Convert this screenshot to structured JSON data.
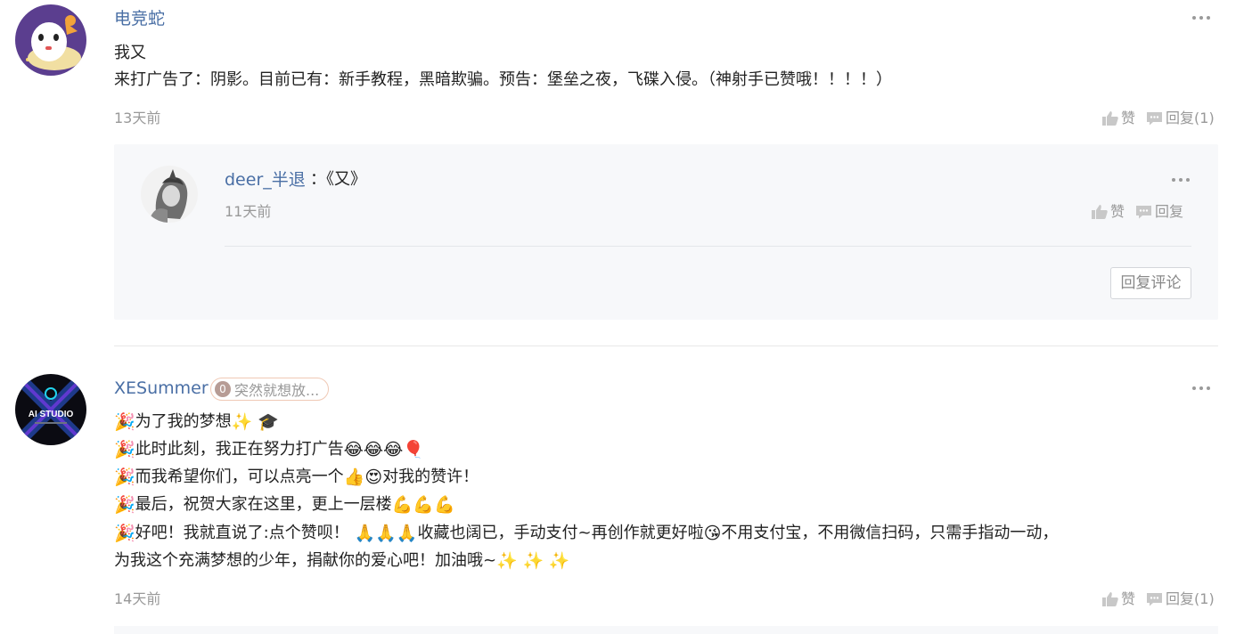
{
  "comments": [
    {
      "username": "电竞蛇",
      "lines": [
        "我又",
        "来打广告了：阴影。目前已有：新手教程，黑暗欺骗。预告：堡垒之夜，飞碟入侵。（神射手已赞哦！！！！）"
      ],
      "time": "13天前",
      "like_label": "赞",
      "reply_label": "回复(1)",
      "replies": [
        {
          "username": "deer_半退",
          "text": "：《又》",
          "time": "11天前",
          "like_label": "赞",
          "reply_label": "回复"
        }
      ],
      "reply_comment_button": "回复评论"
    },
    {
      "username": "XESummer",
      "badge_level": "0",
      "badge_text": "突然就想放...",
      "avatar_text": "AI STUDIO",
      "lines": [
        "为了我的梦想",
        "此时此刻，我正在努力打广告",
        "而我希望你们，可以点亮一个",
        "对我的赞许！",
        "最后，祝贺大家在这里，更上一层楼",
        "好吧！我就直说了:点个赞呗！",
        "收藏也阔已，手动支付~再创作就更好啦",
        "不用支付宝，不用微信扫码，只需手指动一动，",
        "为我这个充满梦想的少年，捐献你的爱心吧！加油哦~"
      ],
      "emojis": {
        "party": "🎉",
        "sparkles": "✨",
        "cap": "🎓",
        "joy": "😂",
        "balloon": "🎈",
        "thumbs": "👍",
        "heart_eyes": "😍",
        "muscle": "💪",
        "pray": "🙏",
        "wink_kiss": "😘"
      },
      "time": "14天前",
      "like_label": "赞",
      "reply_label": "回复(1)"
    }
  ],
  "colors": {
    "username": "#4a6fa5",
    "meta": "#999999",
    "reply_bg": "#f7f8fa"
  }
}
